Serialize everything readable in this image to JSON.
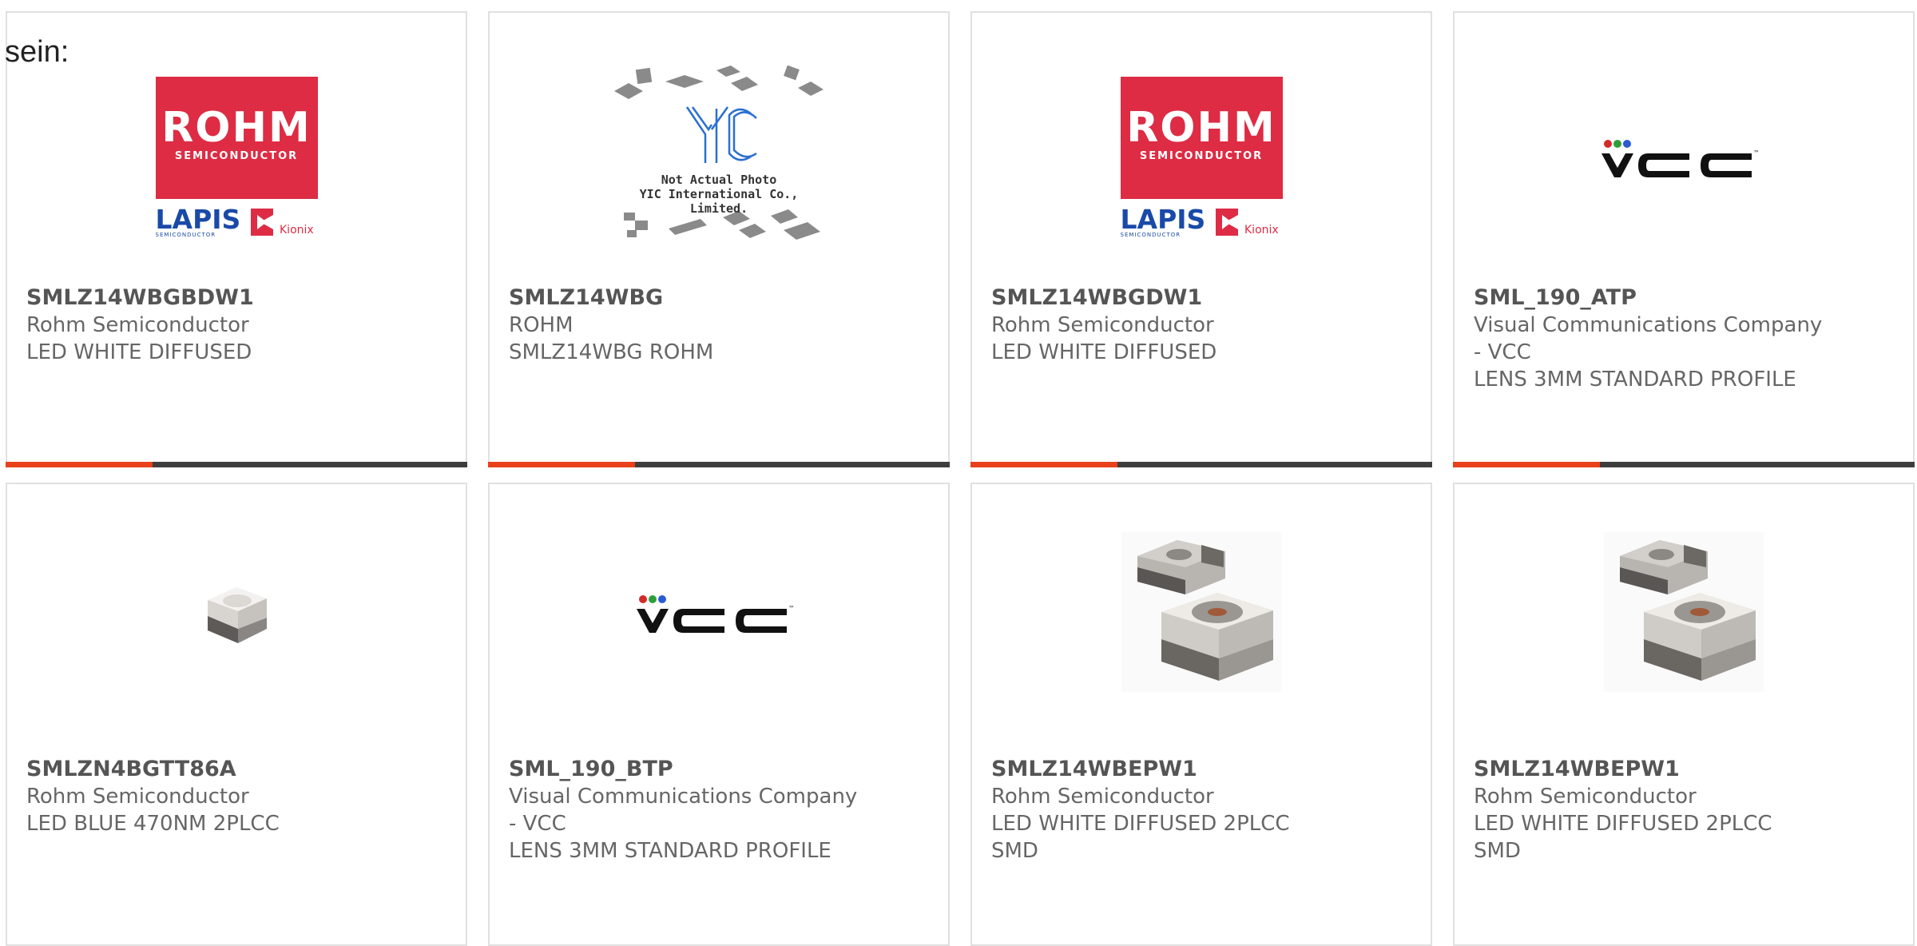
{
  "intro": "sein:",
  "yic_caption": {
    "line1": "Not Actual Photo",
    "line2": "YIC International Co., Limited."
  },
  "logos": {
    "rohm_title": "ROHM",
    "rohm_sub": "SEMICONDUCTOR",
    "lapis": "LAPIS",
    "lapis_sub": "SEMICONDUCTOR",
    "kionix": "Kionix"
  },
  "colors": {
    "accent": "#e8411c",
    "bar": "#3d3d3d",
    "rohm_red": "#dd2c44"
  },
  "products": [
    {
      "part": "SMLZ14WBGBDW1",
      "maker": "Rohm Semiconductor",
      "desc": [
        "LED WHITE DIFFUSED"
      ],
      "image": "rohm-logo"
    },
    {
      "part": "SMLZ14WBG",
      "maker": "ROHM",
      "desc": [
        "SMLZ14WBG ROHM"
      ],
      "image": "yic-placeholder"
    },
    {
      "part": "SMLZ14WBGDW1",
      "maker": "Rohm Semiconductor",
      "desc": [
        "LED WHITE DIFFUSED"
      ],
      "image": "rohm-logo"
    },
    {
      "part": "SML_190_ATP",
      "maker": "Visual Communications Company",
      "maker2": "- VCC",
      "desc": [
        "LENS 3MM STANDARD PROFILE"
      ],
      "image": "vcc-logo"
    },
    {
      "part": "SMLZN4BGTT86A",
      "maker": "Rohm Semiconductor",
      "desc": [
        "LED BLUE 470NM 2PLCC"
      ],
      "image": "led-small"
    },
    {
      "part": "SML_190_BTP",
      "maker": "Visual Communications Company",
      "maker2": "- VCC",
      "desc": [
        "LENS 3MM STANDARD PROFILE"
      ],
      "image": "vcc-logo"
    },
    {
      "part": "SMLZ14WBEPW1",
      "maker": "Rohm Semiconductor",
      "desc": [
        "LED WHITE DIFFUSED 2PLCC",
        "SMD"
      ],
      "image": "led-pair"
    },
    {
      "part": "SMLZ14WBEPW1",
      "maker": "Rohm Semiconductor",
      "desc": [
        "LED WHITE DIFFUSED 2PLCC",
        "SMD"
      ],
      "image": "led-pair"
    }
  ]
}
